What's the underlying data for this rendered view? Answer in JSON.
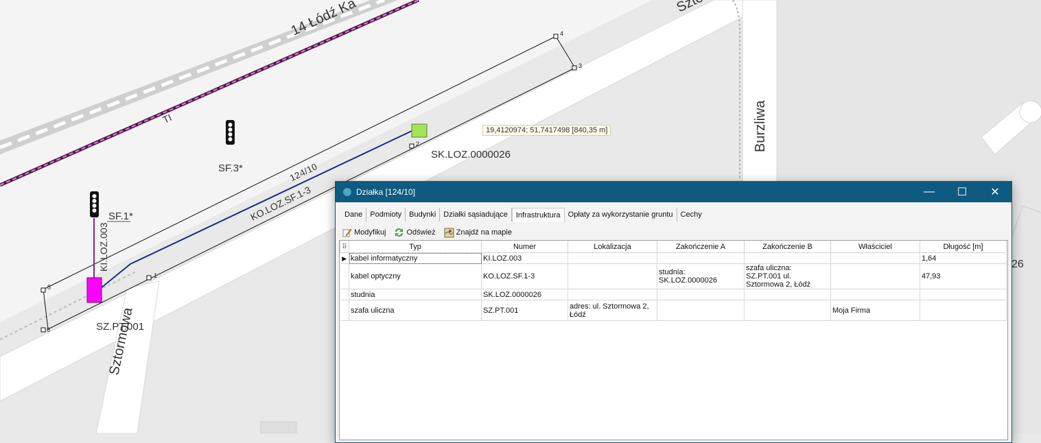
{
  "map": {
    "streets": {
      "lodz_kaliska": "14 Łódź Ka",
      "sztormowa_top": "Sztor",
      "sztormowa": "Sztormowa",
      "burzliwa": "Burzliwa"
    },
    "labels": {
      "ti": "TI",
      "sf3": "SF.3*",
      "sf1": "SF.1*",
      "ki_loz_003": "KI.LOZ.003",
      "sz_pt_001": "SZ.PT.001",
      "sk_loz": "SK.LOZ.0000026",
      "ko_loz": "KO.LOZ.SF.1-3",
      "parcel": "124/10",
      "partial_num": "26"
    },
    "vertices": [
      "1",
      "2",
      "3",
      "4",
      "5",
      "6"
    ],
    "coordinate_tooltip": "19,4120974; 51,7417498  [840,35 m]",
    "colors": {
      "cable_blue": "#1b2a8a",
      "cable_purple": "#8a2090",
      "cabinet_magenta": "#ff00ff",
      "well_green": "#a6e35a"
    }
  },
  "window": {
    "title": "Działka [124/10]",
    "controls": {
      "minimize": "—",
      "maximize": "☐",
      "close": "✕"
    },
    "tabs": [
      "Dane",
      "Podmioty",
      "Budynki",
      "Działki sąsiadujące",
      "Infrastruktura",
      "Opłaty za wykorzystanie gruntu",
      "Cechy"
    ],
    "active_tab": "Infrastruktura",
    "toolbar": {
      "modify": "Modyfikuj",
      "refresh": "Odśwież",
      "find_on_map": "Znajdź na mapie"
    },
    "table": {
      "columns": [
        "Typ",
        "Numer",
        "Lokalizacja",
        "Zakończenie A",
        "Zakończenie B",
        "Właściciel",
        "Długość [m]"
      ],
      "rows": [
        {
          "typ": "kabel informatyczny",
          "numer": "KI.LOZ.003",
          "lokalizacja": "",
          "zak_a": "",
          "zak_b": "",
          "wlasciciel": "",
          "dlugosc": "1,64"
        },
        {
          "typ": "kabel optyczny",
          "numer": "KO.LOZ.SF.1-3",
          "lokalizacja": "",
          "zak_a": "studnia: SK.LOZ.0000026",
          "zak_b": "szafa uliczna: SZ.PT.001 ul. Sztormowa 2, Łódź",
          "wlasciciel": "",
          "dlugosc": "47,93"
        },
        {
          "typ": "studnia",
          "numer": "SK.LOZ.0000026",
          "lokalizacja": "",
          "zak_a": "",
          "zak_b": "",
          "wlasciciel": "",
          "dlugosc": ""
        },
        {
          "typ": "szafa uliczna",
          "numer": "SZ.PT.001",
          "lokalizacja": "adres: ul. Sztormowa 2, Łódź",
          "zak_a": "",
          "zak_b": "",
          "wlasciciel": "Moja Firma",
          "dlugosc": ""
        }
      ]
    }
  }
}
